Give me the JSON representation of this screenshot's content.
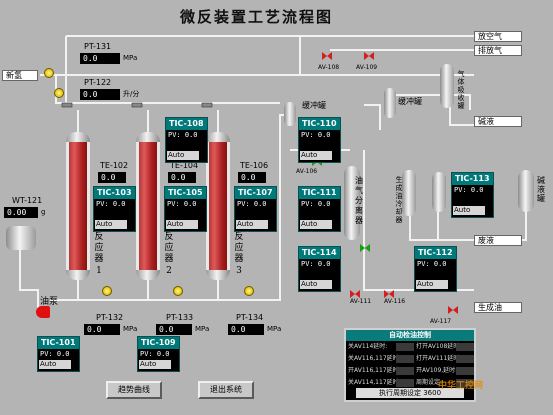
{
  "title": "微反装置工艺流程图",
  "feeds": {
    "left_inlet": "新氢",
    "oil_pump": "油泵"
  },
  "outlets": {
    "vent": "放空气",
    "exhaust": "排放气",
    "alkali": "碱液",
    "waste": "废液",
    "product": "生成油"
  },
  "instruments": {
    "pt131": {
      "tag": "PT-131",
      "value": "0.0",
      "unit": "MPa"
    },
    "pt122": {
      "tag": "PT-122",
      "value": "0.0",
      "unit": "升/分"
    },
    "te102": {
      "tag": "TE-102",
      "value": "0.0"
    },
    "te104": {
      "tag": "TE-104",
      "value": "0.0"
    },
    "te106": {
      "tag": "TE-106",
      "value": "0.0"
    },
    "wt121": {
      "tag": "WT-121",
      "value": "0.00",
      "unit": "g"
    },
    "pt132": {
      "tag": "PT-132",
      "value": "0.0",
      "unit": "MPa"
    },
    "pt133": {
      "tag": "PT-133",
      "value": "0.0",
      "unit": "MPa"
    },
    "pt134": {
      "tag": "PT-134",
      "value": "0.0",
      "unit": "MPa"
    }
  },
  "controllers": [
    {
      "tag": "TIC-108",
      "pv": "PV: 0.0",
      "mode": "Auto"
    },
    {
      "tag": "TIC-103",
      "pv": "PV: 0.0",
      "mode": "Auto"
    },
    {
      "tag": "TIC-105",
      "pv": "PV: 0.0",
      "mode": "Auto"
    },
    {
      "tag": "TIC-107",
      "pv": "PV: 0.0",
      "mode": "Auto"
    },
    {
      "tag": "TIC-110",
      "pv": "PV: 0.0",
      "mode": "Auto"
    },
    {
      "tag": "TIC-111",
      "pv": "PV: 0.0",
      "mode": "Auto"
    },
    {
      "tag": "TIC-113",
      "pv": "PV: 0.0",
      "mode": "Auto"
    },
    {
      "tag": "TIC-114",
      "pv": "PV: 0.0",
      "mode": "Auto"
    },
    {
      "tag": "TIC-112",
      "pv": "PV: 0.0",
      "mode": "Auto"
    },
    {
      "tag": "TIC-101",
      "pv": "PV: 0.0",
      "mode": "Auto"
    },
    {
      "tag": "TIC-109",
      "pv": "PV: 0.0",
      "mode": "Auto"
    }
  ],
  "reactors": [
    {
      "label": "反应器",
      "num": "1"
    },
    {
      "label": "反应器",
      "num": "2"
    },
    {
      "label": "反应器",
      "num": "3"
    }
  ],
  "vessels": {
    "buffer1": "缓冲罐",
    "buffer2": "缓冲罐",
    "gas_tank": "气体吸收罐",
    "oil_gas_sep": "油气分离器",
    "product_cool": "生成油冷却器",
    "alkali_tank": "碱液罐"
  },
  "valves": {
    "av106": "AV-106",
    "av108": "AV-108",
    "av109": "AV-109",
    "av106b": "AV-106",
    "av111": "AV-111",
    "av116": "AV-116",
    "av117": "AV-117"
  },
  "buttons": {
    "trend": "趋势曲线",
    "exit": "退出系统"
  },
  "panel": {
    "title": "自动检油控制",
    "rows": [
      {
        "left": "关AV114延时:",
        "right": "打开AV108延时:"
      },
      {
        "left": "关AV116,117延时:",
        "right": "打开AV111延时:"
      },
      {
        "left": "开AV116,117延时:",
        "right": "开AV109,延时:"
      },
      {
        "left": "关AV114,117延时:",
        "right": "周期设定:"
      }
    ],
    "footer": "执行周期设定",
    "footer_value": "3600"
  },
  "watermark": "中华工控网",
  "colors": {
    "controller_header": "#00797b",
    "reactor_red": "#d04040",
    "pipe": "#f0f0f0",
    "background": "#b4b4b4"
  }
}
